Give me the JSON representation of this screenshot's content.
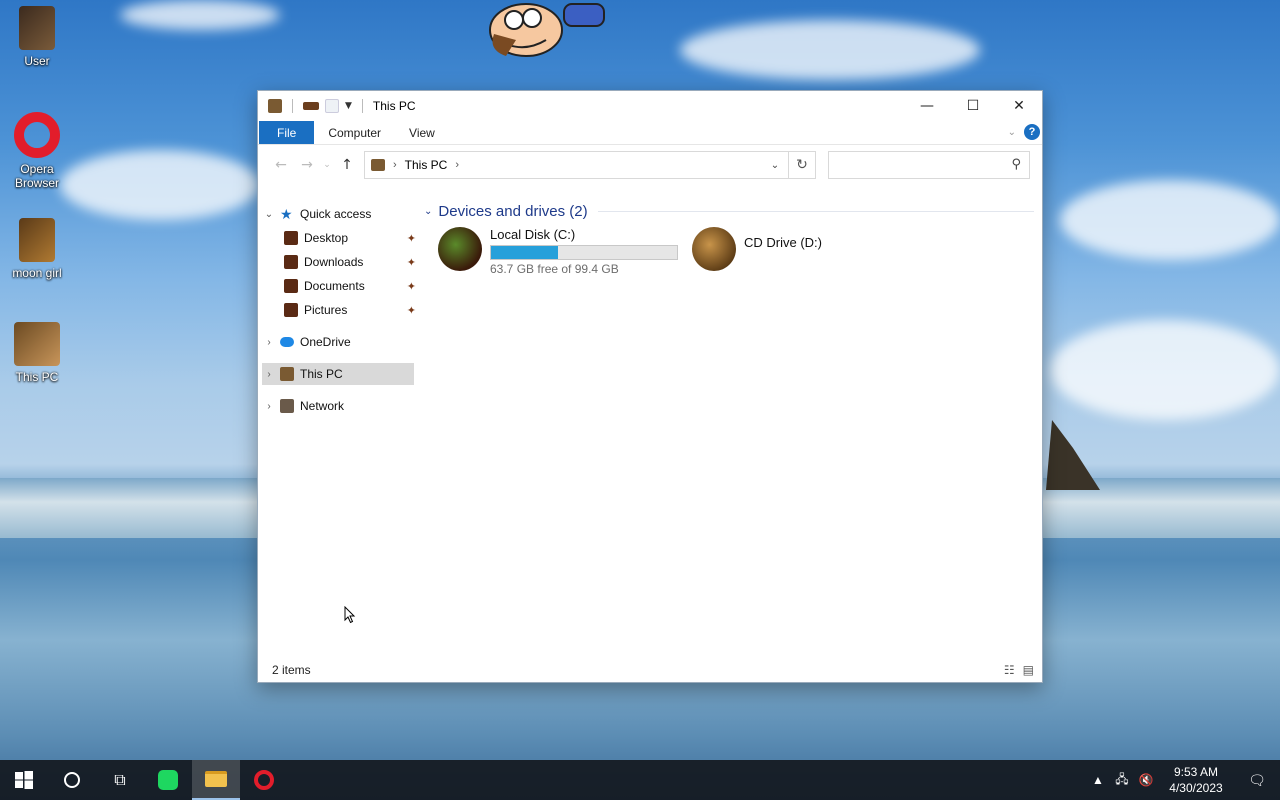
{
  "desktop": {
    "icons": [
      {
        "label": "User"
      },
      {
        "label": "Opera Browser"
      },
      {
        "label": "moon girl"
      },
      {
        "label": "This PC"
      }
    ]
  },
  "window": {
    "title": "This PC",
    "controls": {
      "minimize": "—",
      "maximize": "☐",
      "close": "✕"
    },
    "ribbon": {
      "tabs": [
        "File",
        "Computer",
        "View"
      ],
      "help": "?"
    },
    "address": {
      "location": "This PC",
      "search_placeholder": ""
    },
    "nav": {
      "quick_access": "Quick access",
      "quick_items": [
        "Desktop",
        "Downloads",
        "Documents",
        "Pictures"
      ],
      "onedrive": "OneDrive",
      "this_pc": "This PC",
      "network": "Network"
    },
    "content": {
      "group_title": "Devices and drives (2)",
      "drives": [
        {
          "name": "Local Disk (C:)",
          "free_text": "63.7 GB free of 99.4 GB",
          "used_fraction": 0.36
        },
        {
          "name": "CD Drive (D:)"
        }
      ]
    },
    "status": {
      "items": "2 items"
    }
  },
  "taskbar": {
    "clock_time": "9:53 AM",
    "clock_date": "4/30/2023"
  },
  "colors": {
    "accent": "#1a6fc2",
    "progress": "#26a0da",
    "group_heading": "#1e3a8a"
  }
}
